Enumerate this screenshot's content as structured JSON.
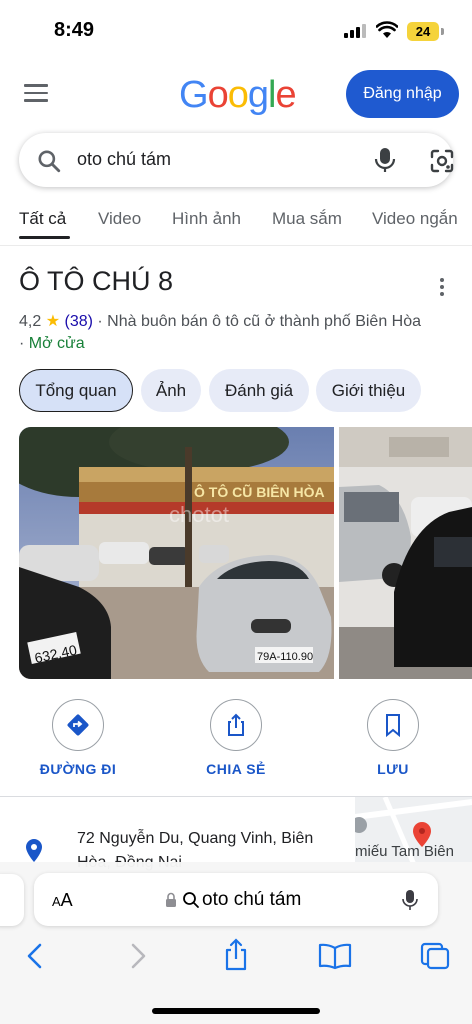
{
  "status": {
    "time": "8:49",
    "battery": "24"
  },
  "header": {
    "logo_letters": [
      "G",
      "o",
      "o",
      "g",
      "l",
      "e"
    ],
    "logo_colors": [
      "#4285f4",
      "#ea4335",
      "#fbbc05",
      "#4285f4",
      "#34a853",
      "#ea4335"
    ],
    "login_label": "Đăng nhập"
  },
  "search": {
    "query": "oto chú tám"
  },
  "tabs": [
    {
      "label": "Tất cả"
    },
    {
      "label": "Video"
    },
    {
      "label": "Hình ảnh"
    },
    {
      "label": "Mua sắm"
    },
    {
      "label": "Video ngắn"
    }
  ],
  "business": {
    "title": "Ô TÔ CHÚ 8",
    "rating": "4,2",
    "review_count": "(38)",
    "category": "· Nhà buôn bán ô tô cũ ở thành phố Biên Hòa",
    "open_prefix": "·",
    "open_status": "Mở cửa"
  },
  "chips": [
    {
      "label": "Tổng quan"
    },
    {
      "label": "Ảnh"
    },
    {
      "label": "Đánh giá"
    },
    {
      "label": "Giới thiệu"
    }
  ],
  "photo": {
    "sign_text": "Ô TÔ CŨ BIÊN HÒA",
    "plate_left": "632.40",
    "plate_center": "79A-110.90",
    "watermark": "chotot"
  },
  "actions": [
    {
      "label": "ĐƯỜNG ĐI"
    },
    {
      "label": "CHIA SẺ"
    },
    {
      "label": "LƯU"
    }
  ],
  "address": {
    "line1": "72 Nguyễn Du, Quang Vinh, Biên",
    "line2": "Hòa, Đồng Nai"
  },
  "map": {
    "label": "miếu Tam Biên"
  },
  "safari": {
    "aa_small": "A",
    "aa_big": "A",
    "url_text": "oto chú tám"
  },
  "colors": {
    "accent_blue": "#1f5ad0",
    "chip_bg": "#e7ebf7",
    "open_green": "#188038"
  }
}
